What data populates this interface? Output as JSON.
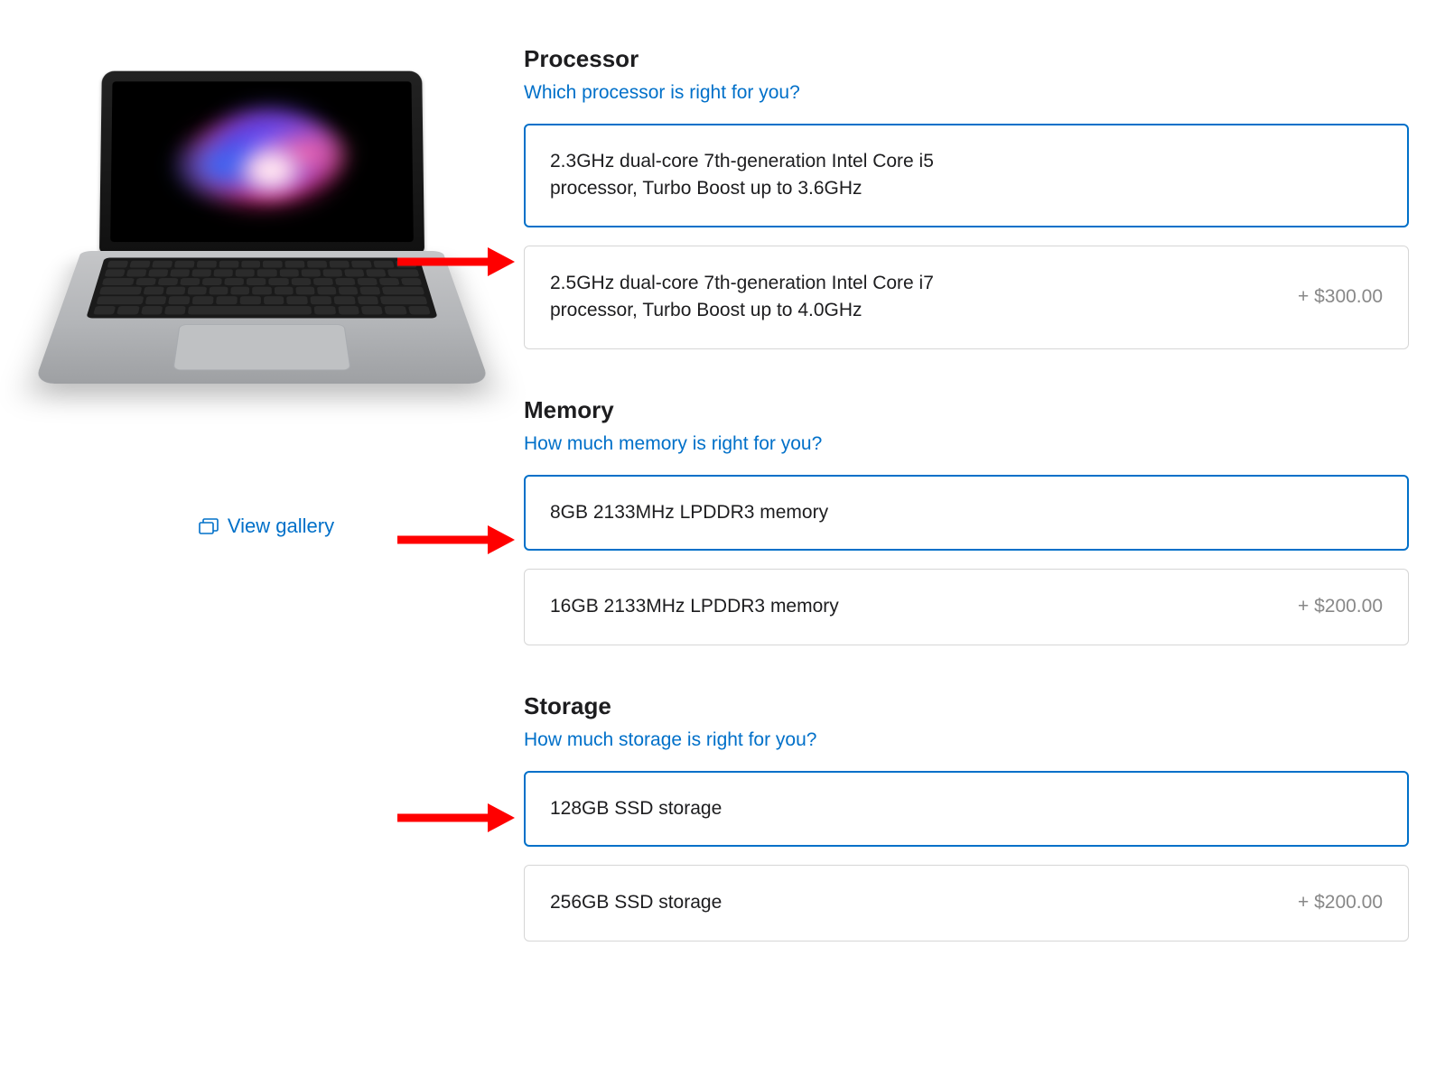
{
  "gallery": {
    "label": "View gallery"
  },
  "sections": {
    "processor": {
      "title": "Processor",
      "help": "Which processor is right for you?",
      "options": [
        {
          "text": "2.3GHz dual-core 7th-generation Intel Core i5 processor, Turbo Boost up to 3.6GHz",
          "price": ""
        },
        {
          "text": "2.5GHz dual-core 7th-generation Intel Core i7 processor, Turbo Boost up to 4.0GHz",
          "price": "+ $300.00"
        }
      ]
    },
    "memory": {
      "title": "Memory",
      "help": "How much memory is right for you?",
      "options": [
        {
          "text": "8GB 2133MHz LPDDR3 memory",
          "price": ""
        },
        {
          "text": "16GB 2133MHz LPDDR3 memory",
          "price": "+ $200.00"
        }
      ]
    },
    "storage": {
      "title": "Storage",
      "help": "How much storage is right for you?",
      "options": [
        {
          "text": "128GB SSD storage",
          "price": ""
        },
        {
          "text": "256GB SSD storage",
          "price": "+ $200.00"
        }
      ]
    }
  }
}
